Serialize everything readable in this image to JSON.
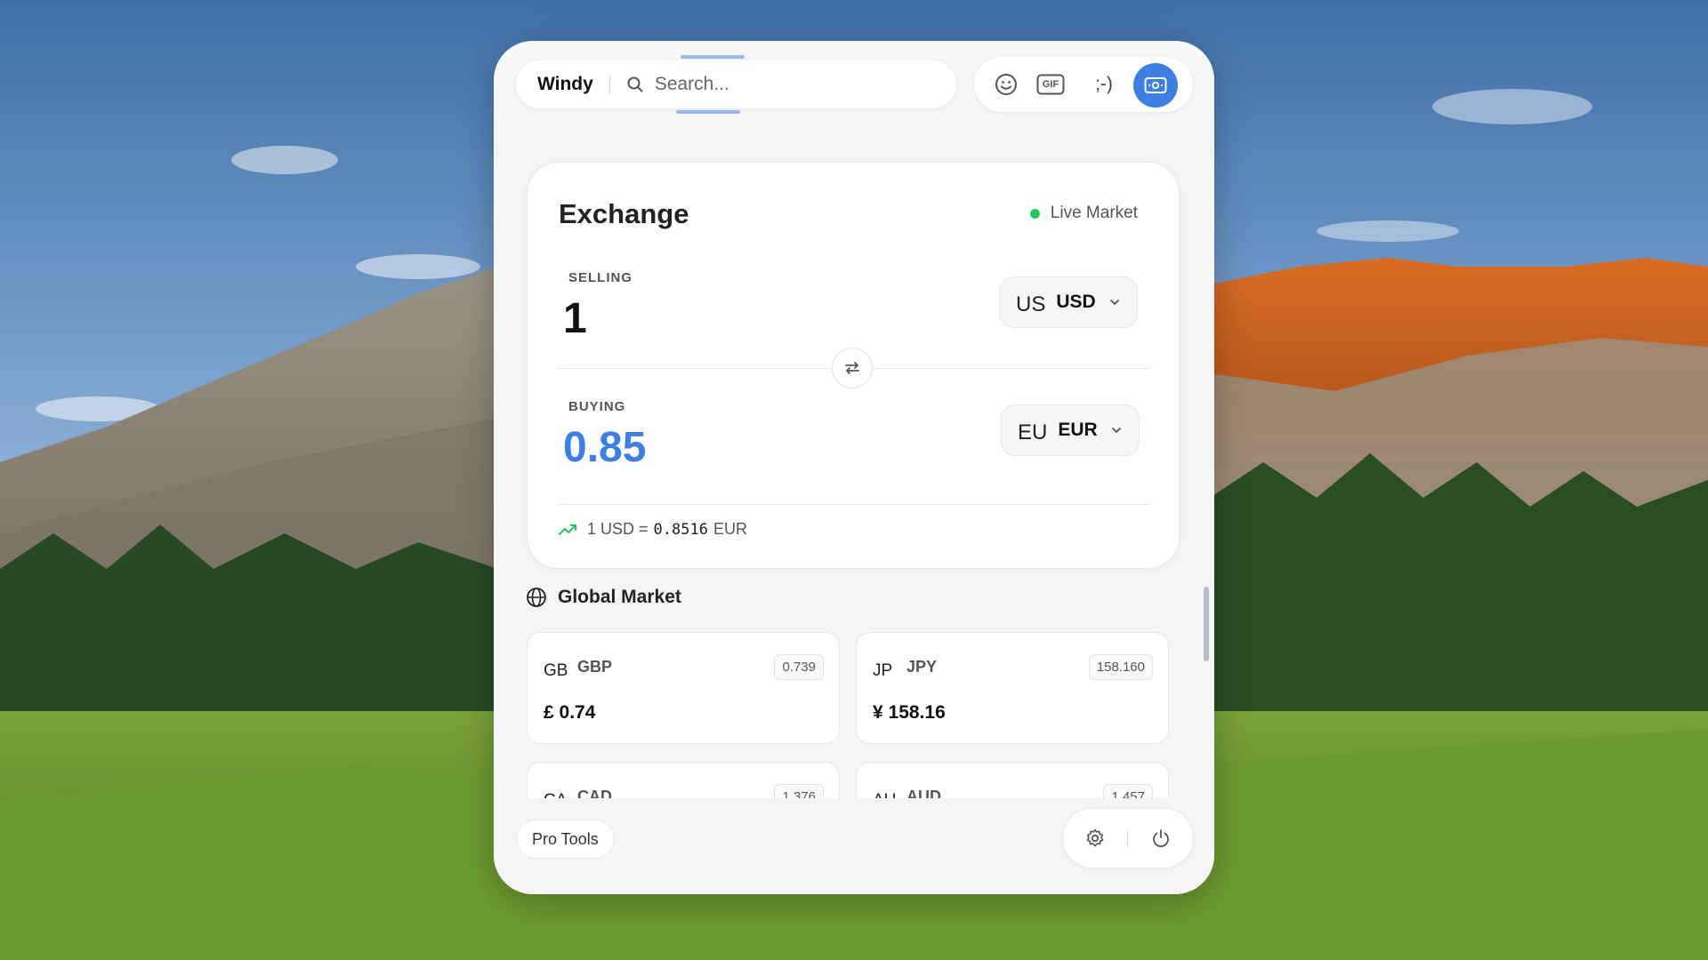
{
  "header": {
    "app_name": "Windy",
    "search_placeholder": "Search...",
    "tools": {
      "emoji": "emoji-icon",
      "gif_label": "GIF",
      "kaomoji_label": ";-)",
      "money": "money-icon"
    }
  },
  "exchange": {
    "title": "Exchange",
    "status": "Live Market",
    "selling_label": "SELLING",
    "selling_amount": "1",
    "selling_flag": "US",
    "selling_code": "USD",
    "buying_label": "BUYING",
    "buying_amount": "0.85",
    "buying_flag": "EU",
    "buying_code": "EUR",
    "rate_prefix": "1 USD =",
    "rate_value": "0.8516",
    "rate_suffix": "EUR"
  },
  "global_market": {
    "title": "Global Market",
    "cards": [
      {
        "flag": "GB",
        "code": "GBP",
        "rate": "0.739",
        "value": "£ 0.74"
      },
      {
        "flag": "JP",
        "code": "JPY",
        "rate": "158.160",
        "value": "¥ 158.16"
      },
      {
        "flag": "CA",
        "code": "CAD",
        "rate": "1.376",
        "value": ""
      },
      {
        "flag": "AU",
        "code": "AUD",
        "rate": "1.457",
        "value": ""
      }
    ]
  },
  "footer": {
    "pro_tools": "Pro Tools"
  },
  "colors": {
    "accent": "#3d7fe3",
    "live": "#22c55e",
    "trend": "#22c55e"
  }
}
